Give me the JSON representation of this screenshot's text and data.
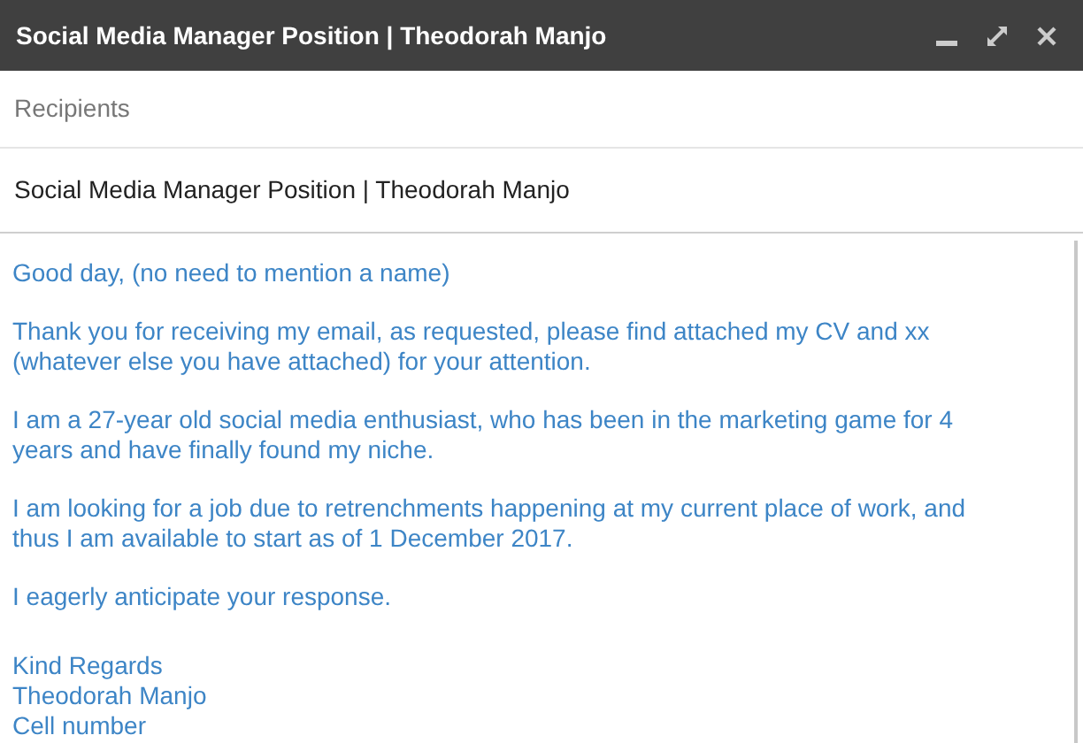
{
  "window": {
    "title": "Social Media Manager Position | Theodorah Manjo"
  },
  "recipients": {
    "placeholder": "Recipients"
  },
  "subject": {
    "value": "Social Media Manager Position | Theodorah Manjo"
  },
  "body": {
    "paragraphs": [
      "Good day, (no need to mention a name)",
      "Thank you for receiving my email, as requested, please find attached my CV and xx (whatever else you have attached) for your attention.",
      "I am a 27-year old social media enthusiast, who has been in the marketing game for 4 years and have finally found my niche.",
      "I am looking for a job due to retrenchments happening at my current place of work, and thus I am available to start as of 1 December 2017.",
      "I eagerly anticipate your response."
    ],
    "signature": [
      "Kind Regards",
      "Theodorah Manjo",
      "Cell number"
    ]
  }
}
